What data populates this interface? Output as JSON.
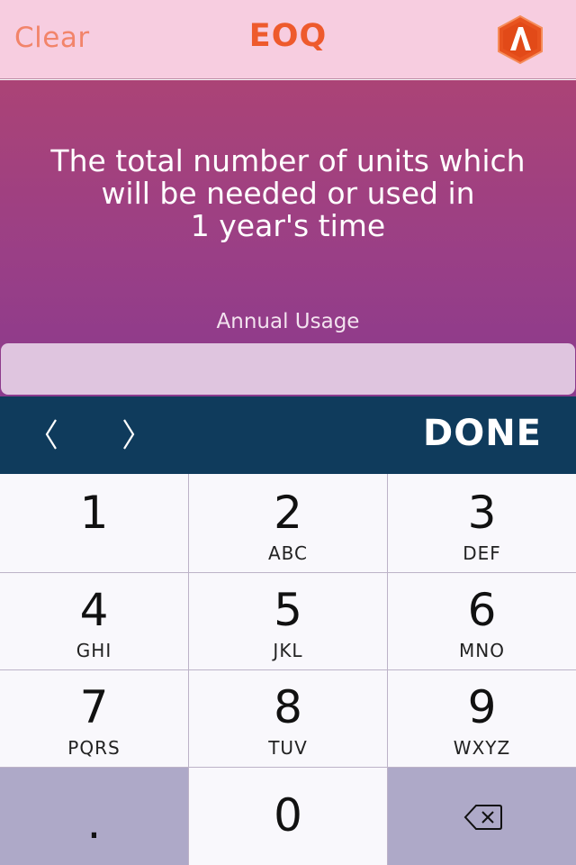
{
  "header": {
    "clear_label": "Clear",
    "title": "EOQ",
    "logo_icon": "hexagon-logo-icon"
  },
  "hero": {
    "description": "The total number of units which\nwill be needed or used in\n1 year's time",
    "field_label": "Annual Usage",
    "field_value": "",
    "field_placeholder": ""
  },
  "toolbar": {
    "prev_icon": "chevron-left-icon",
    "next_icon": "chevron-right-icon",
    "done_label": "DONE"
  },
  "keypad": {
    "keys": [
      {
        "digit": "1",
        "letters": ""
      },
      {
        "digit": "2",
        "letters": "ABC"
      },
      {
        "digit": "3",
        "letters": "DEF"
      },
      {
        "digit": "4",
        "letters": "GHI"
      },
      {
        "digit": "5",
        "letters": "JKL"
      },
      {
        "digit": "6",
        "letters": "MNO"
      },
      {
        "digit": "7",
        "letters": "PQRS"
      },
      {
        "digit": "8",
        "letters": "TUV"
      },
      {
        "digit": "9",
        "letters": "WXYZ"
      }
    ],
    "decimal": ".",
    "zero": "0",
    "backspace_icon": "backspace-icon"
  },
  "colors": {
    "header_bg": "#f7cde0",
    "accent": "#ee5a2d",
    "toolbar_bg": "#0f3b5c",
    "hero_top": "#ab4376",
    "hero_bottom": "#8b3a8d"
  }
}
